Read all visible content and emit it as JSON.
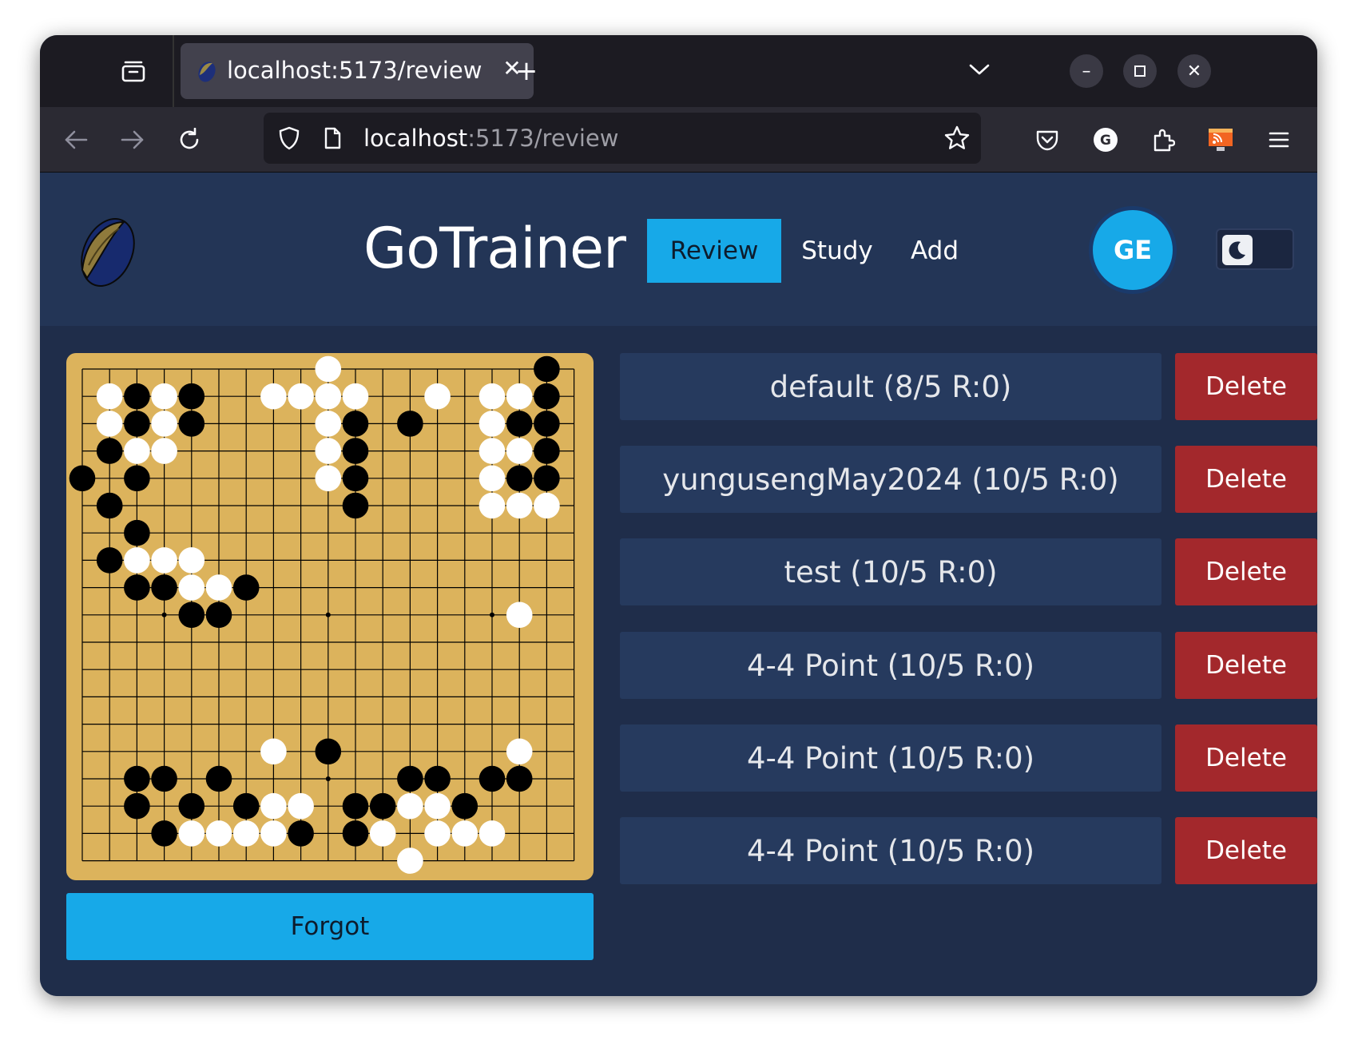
{
  "browser": {
    "tab_title": "localhost:5173/review",
    "url_host": "localhost",
    "url_rest": ":5173/review"
  },
  "app": {
    "brand": "GoTrainer",
    "nav": [
      {
        "label": "Review",
        "active": true
      },
      {
        "label": "Study",
        "active": false
      },
      {
        "label": "Add",
        "active": false
      }
    ],
    "avatar_initials": "GE",
    "theme_toggle_icon": "moon-icon"
  },
  "decks": [
    {
      "label": "default (8/5 R:0)",
      "delete_label": "Delete"
    },
    {
      "label": "yungusengMay2024 (10/5 R:0)",
      "delete_label": "Delete"
    },
    {
      "label": "test (10/5 R:0)",
      "delete_label": "Delete"
    },
    {
      "label": "4-4 Point (10/5 R:0)",
      "delete_label": "Delete"
    },
    {
      "label": "4-4 Point (10/5 R:0)",
      "delete_label": "Delete"
    },
    {
      "label": "4-4 Point (10/5 R:0)",
      "delete_label": "Delete"
    }
  ],
  "forgot_label": "Forgot",
  "board": {
    "size": 19,
    "colors": {
      "wood": "#dcb35c",
      "black": "#000000",
      "white": "#ffffff",
      "line": "#000000"
    },
    "black": [
      [
        17,
        0
      ],
      [
        2,
        1
      ],
      [
        4,
        1
      ],
      [
        17,
        1
      ],
      [
        2,
        2
      ],
      [
        10,
        2
      ],
      [
        4,
        2
      ],
      [
        12,
        2
      ],
      [
        16,
        2
      ],
      [
        17,
        2
      ],
      [
        1,
        3
      ],
      [
        10,
        3
      ],
      [
        17,
        3
      ],
      [
        0,
        4
      ],
      [
        2,
        4
      ],
      [
        10,
        4
      ],
      [
        16,
        4
      ],
      [
        17,
        4
      ],
      [
        1,
        5
      ],
      [
        10,
        5
      ],
      [
        2,
        6
      ],
      [
        1,
        7
      ],
      [
        2,
        8
      ],
      [
        3,
        8
      ],
      [
        6,
        8
      ],
      [
        4,
        9
      ],
      [
        5,
        9
      ],
      [
        9,
        14
      ],
      [
        2,
        15
      ],
      [
        3,
        15
      ],
      [
        5,
        15
      ],
      [
        12,
        15
      ],
      [
        13,
        15
      ],
      [
        15,
        15
      ],
      [
        16,
        15
      ],
      [
        2,
        16
      ],
      [
        4,
        16
      ],
      [
        6,
        16
      ],
      [
        10,
        16
      ],
      [
        11,
        16
      ],
      [
        14,
        16
      ],
      [
        3,
        17
      ],
      [
        8,
        17
      ],
      [
        10,
        17
      ]
    ],
    "white": [
      [
        9,
        0
      ],
      [
        1,
        1
      ],
      [
        3,
        1
      ],
      [
        7,
        1
      ],
      [
        8,
        1
      ],
      [
        9,
        1
      ],
      [
        10,
        1
      ],
      [
        13,
        1
      ],
      [
        15,
        1
      ],
      [
        16,
        1
      ],
      [
        1,
        2
      ],
      [
        3,
        2
      ],
      [
        9,
        2
      ],
      [
        15,
        2
      ],
      [
        2,
        3
      ],
      [
        3,
        3
      ],
      [
        9,
        3
      ],
      [
        15,
        3
      ],
      [
        16,
        3
      ],
      [
        9,
        4
      ],
      [
        15,
        4
      ],
      [
        15,
        5
      ],
      [
        16,
        5
      ],
      [
        17,
        5
      ],
      [
        4,
        7
      ],
      [
        2,
        7
      ],
      [
        3,
        7
      ],
      [
        4,
        8
      ],
      [
        5,
        8
      ],
      [
        16,
        9
      ],
      [
        7,
        14
      ],
      [
        16,
        14
      ],
      [
        7,
        16
      ],
      [
        8,
        16
      ],
      [
        12,
        16
      ],
      [
        13,
        16
      ],
      [
        4,
        17
      ],
      [
        5,
        17
      ],
      [
        6,
        17
      ],
      [
        7,
        17
      ],
      [
        11,
        17
      ],
      [
        13,
        17
      ],
      [
        14,
        17
      ],
      [
        15,
        17
      ],
      [
        12,
        18
      ]
    ]
  }
}
